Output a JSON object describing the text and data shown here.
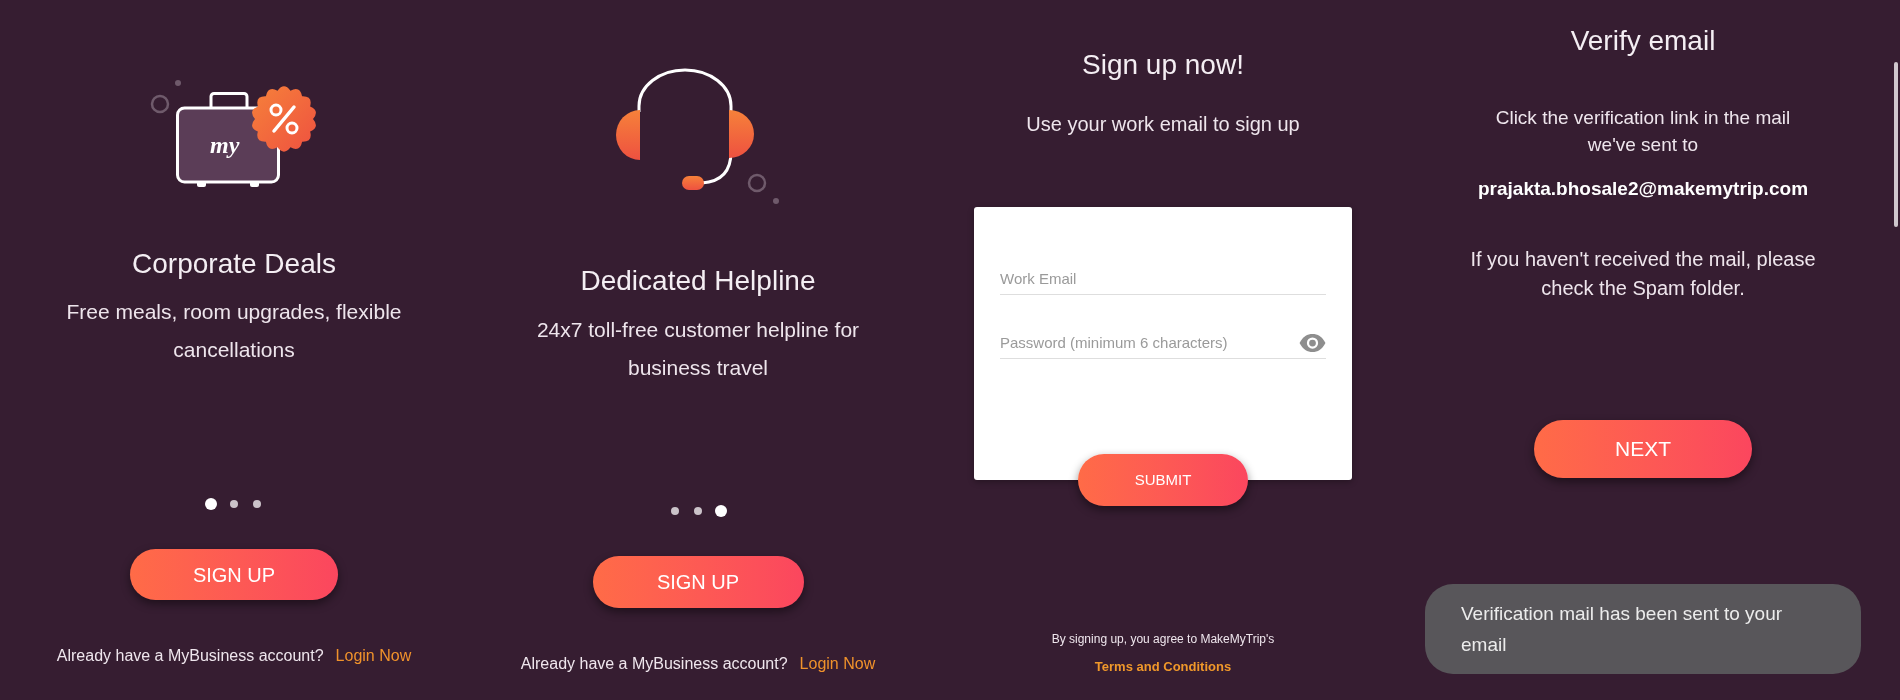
{
  "slides": [
    {
      "title": "Corporate Deals",
      "description": [
        "Free meals, room upgrades, flexible",
        "cancellations"
      ],
      "logo_text": "my",
      "pager": [
        {
          "selected": true
        },
        {
          "selected": false
        },
        {
          "selected": false
        }
      ],
      "button": "SIGN UP",
      "footer_text": "Already have a MyBusiness account?",
      "footer_link": "Login Now"
    },
    {
      "title": "Dedicated Helpline",
      "description": [
        "24x7 toll-free customer helpline for",
        "business travel"
      ],
      "pager": [
        {
          "selected": false
        },
        {
          "selected": false
        },
        {
          "selected": true
        }
      ],
      "button": "SIGN UP",
      "footer_text": "Already have a MyBusiness account?",
      "footer_link": "Login Now"
    }
  ],
  "signup": {
    "title": "Sign up now!",
    "subtitle": "Use your work email to sign up",
    "fields": [
      {
        "kind": "text",
        "placeholder": "Work Email"
      },
      {
        "kind": "password",
        "placeholder": "Password (minimum 6 characters)"
      }
    ],
    "button": "SUBMIT",
    "terms_text": "By signing up, you agree to MakeMyTrip's",
    "terms_link": "Terms and Conditions"
  },
  "verify": {
    "title": "Verify email",
    "message": [
      "Click the verification link in the mail",
      "we've sent to"
    ],
    "email": "prajakta.bhosale2@makemytrip.com",
    "note": [
      "If you haven't received the mail, please",
      "check the Spam folder."
    ],
    "button": "NEXT"
  },
  "toast": {
    "message": [
      "Verification mail has been sent to your",
      "email"
    ]
  }
}
